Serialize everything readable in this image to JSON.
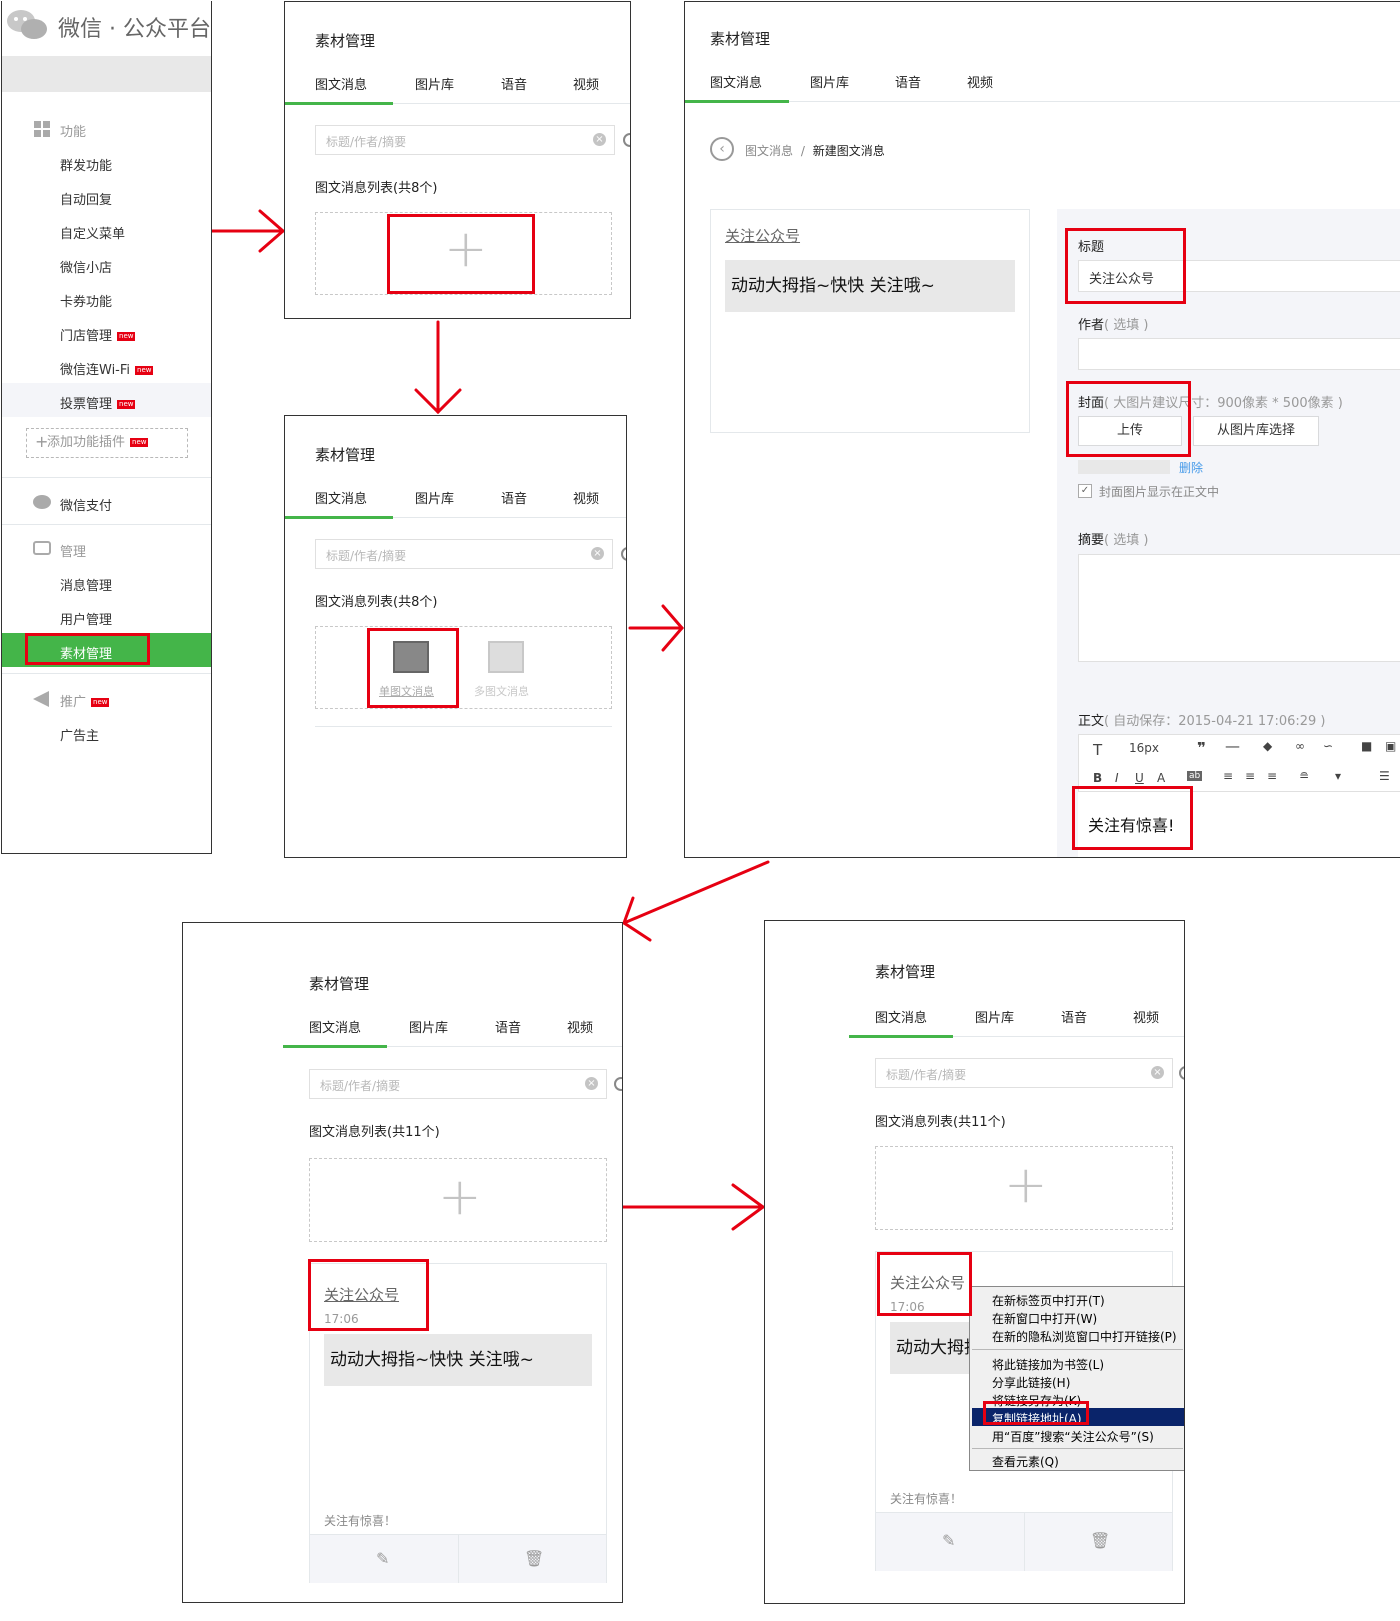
{
  "sidebar": {
    "logo_text": "微信 · 公众平台",
    "group_function": "功能",
    "items_function": [
      "群发功能",
      "自动回复",
      "自定义菜单",
      "微信小店",
      "卡券功能",
      "门店管理",
      "微信连Wi-Fi",
      "投票管理"
    ],
    "new_badge": "new",
    "add_plugin": "添加功能插件",
    "pay": "微信支付",
    "group_manage": "管理",
    "items_manage": [
      "消息管理",
      "用户管理",
      "素材管理"
    ],
    "group_promote": "推广",
    "items_promote": [
      "广告主"
    ]
  },
  "material": {
    "title": "素材管理",
    "tabs": [
      "图文消息",
      "图片库",
      "语音",
      "视频"
    ],
    "search_placeholder": "标题/作者/摘要",
    "list_label_8": "图文消息列表(共8个)",
    "list_label_11": "图文消息列表(共11个)",
    "single_article": "单图文消息",
    "multi_article": "多图文消息"
  },
  "editor": {
    "breadcrumb_parent": "图文消息",
    "breadcrumb_sep": "/",
    "breadcrumb_current": "新建图文消息",
    "preview_title": "关注公众号",
    "banner_text": "动动大拇指~快快 关注哦~",
    "title_label": "标题",
    "title_value": "关注公众号",
    "author_label": "作者",
    "author_hint": "( 选填 )",
    "cover_label": "封面",
    "cover_hint": "( 大图片建议尺寸：900像素 * 500像素 )",
    "upload_btn": "上传",
    "library_btn": "从图片库选择",
    "delete_link": "删除",
    "cover_check": "封面图片显示在正文中",
    "summary_label": "摘要",
    "summary_hint": "( 选填 )",
    "body_label": "正文",
    "autosave": "( 自动保存：2015-04-21 17:06:29 )",
    "font_size": "16px",
    "body_text": "关注有惊喜!"
  },
  "result_card": {
    "title": "关注公众号",
    "time": "17:06",
    "body": "关注有惊喜！"
  },
  "context_menu": {
    "items": [
      "在新标签页中打开(T)",
      "在新窗口中打开(W)",
      "在新的隐私浏览窗口中打开链接(P)",
      "将此链接加为书签(L)",
      "分享此链接(H)",
      "将链接另存为(K)",
      "复制链接地址(A)",
      "用“百度”搜索“关注公众号”(S)",
      "查看元素(Q)"
    ],
    "highlighted_index": 6
  },
  "colors": {
    "accent": "#44b549",
    "annotation": "#e60012",
    "menu_highlight": "#0a246a"
  }
}
